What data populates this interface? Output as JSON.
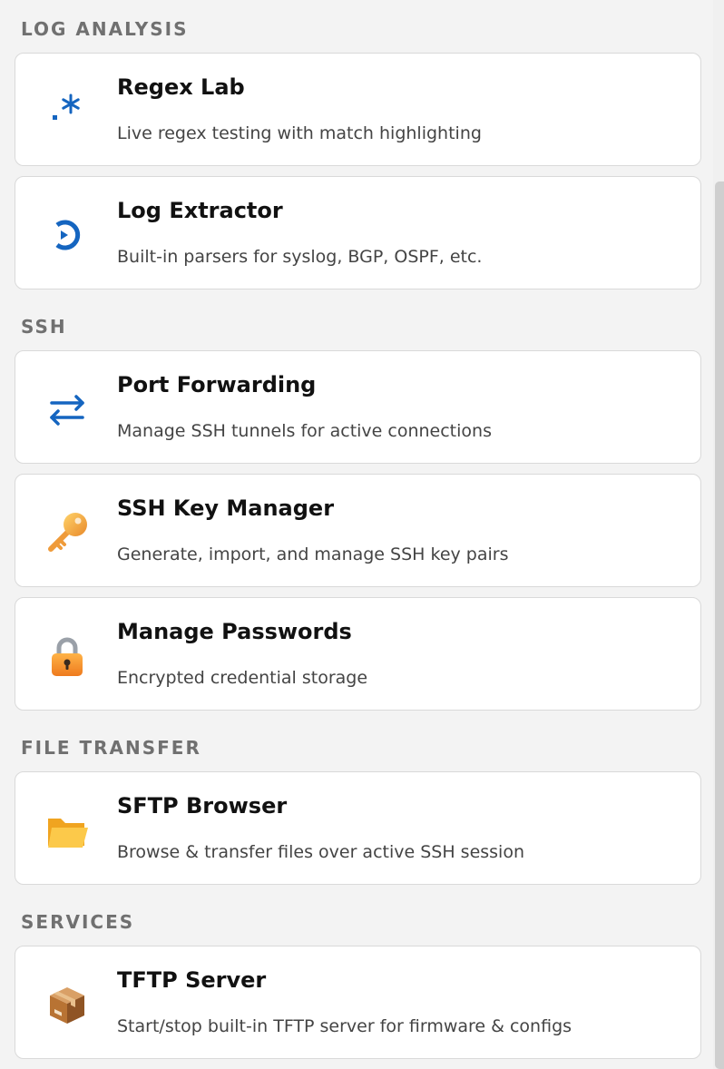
{
  "sections": [
    {
      "header": "LOG ANALYSIS",
      "cards": [
        {
          "title": "Regex Lab",
          "description": "Live regex testing with match highlighting",
          "icon": "regex-icon",
          "icon_color": "#1565c0"
        },
        {
          "title": "Log Extractor",
          "description": "Built-in parsers for syslog, BGP, OSPF, etc.",
          "icon": "log-extract-icon",
          "icon_color": "#1565c0"
        }
      ]
    },
    {
      "header": "SSH",
      "cards": [
        {
          "title": "Port Forwarding",
          "description": "Manage SSH tunnels for active connections",
          "icon": "swap-arrows-icon",
          "icon_color": "#1565c0"
        },
        {
          "title": "SSH Key Manager",
          "description": "Generate, import, and manage SSH key pairs",
          "icon": "key-icon",
          "icon_color": "#f4a33a"
        },
        {
          "title": "Manage Passwords",
          "description": "Encrypted credential storage",
          "icon": "padlock-icon",
          "icon_color": "#f28c28"
        }
      ]
    },
    {
      "header": "FILE TRANSFER",
      "cards": [
        {
          "title": "SFTP Browser",
          "description": "Browse & transfer files over active SSH session",
          "icon": "folder-icon",
          "icon_color": "#fbbf3b"
        }
      ]
    },
    {
      "header": "SERVICES",
      "cards": [
        {
          "title": "TFTP Server",
          "description": "Start/stop built-in TFTP server for firmware & configs",
          "icon": "package-icon",
          "icon_color": "#b87333"
        }
      ]
    }
  ],
  "colors": {
    "background": "#f3f3f3",
    "card_background": "#ffffff",
    "card_border": "#d9d9d9",
    "section_header": "#707070",
    "title_text": "#111111",
    "description_text": "#444444",
    "accent_blue": "#1565c0"
  }
}
